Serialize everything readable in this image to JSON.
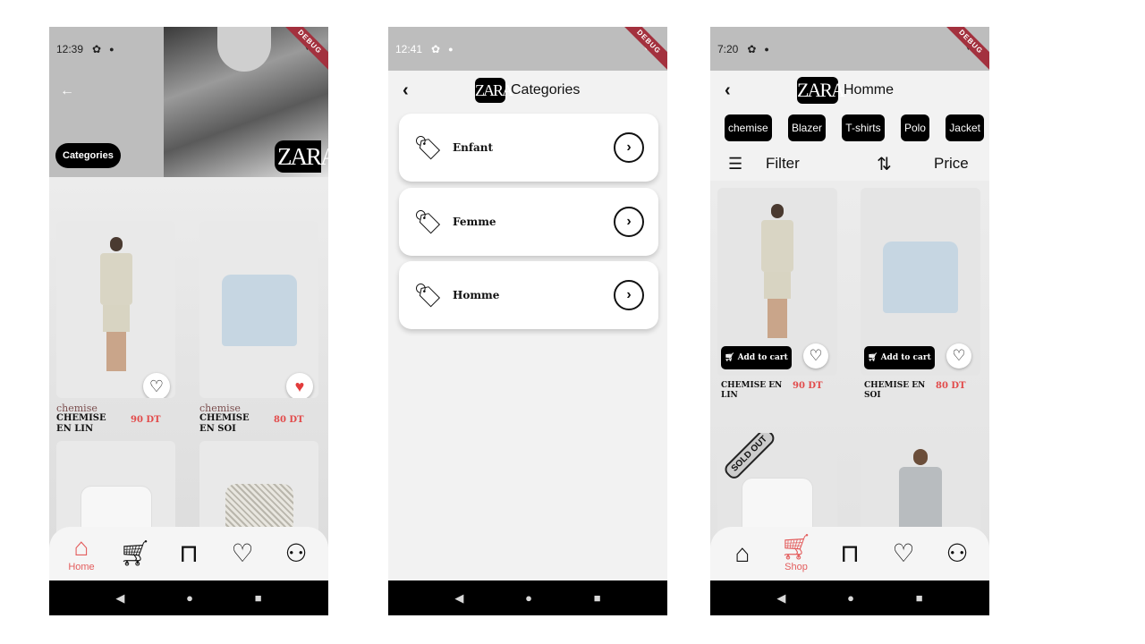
{
  "phone1": {
    "status": {
      "time": "12:39",
      "debug": "DEBUG"
    },
    "header": {
      "categories_btn": "Categories",
      "logo": "ZARA"
    },
    "products": [
      {
        "category": "chemise",
        "name": "CHEMISE EN LIN",
        "price": "90 DT",
        "favorite": false
      },
      {
        "category": "chemise",
        "name": "CHEMISE EN SOI",
        "price": "80 DT",
        "favorite": true
      }
    ],
    "nav": {
      "home_label": "Home"
    }
  },
  "phone2": {
    "status": {
      "time": "12:41",
      "debug": "DEBUG"
    },
    "appbar": {
      "logo": "ZARA",
      "title": "Categories"
    },
    "categories": [
      {
        "name": "Enfant"
      },
      {
        "name": "Femme"
      },
      {
        "name": "Homme"
      }
    ]
  },
  "phone3": {
    "status": {
      "time": "7:20",
      "debug": "DEBUG"
    },
    "appbar": {
      "logo": "ZARA",
      "title": "Homme"
    },
    "chips": [
      "chemise",
      "Blazer",
      "T-shirts",
      "Polo",
      "Jacket"
    ],
    "filter_label": "Filter",
    "sort_label": "Price",
    "products": [
      {
        "name": "CHEMISE EN LIN",
        "price": "90 DT",
        "cart_label": "Add to cart"
      },
      {
        "name": "CHEMISE EN SOI",
        "price": "80 DT",
        "cart_label": "Add to cart"
      }
    ],
    "sold_out": "SOLD OUT",
    "nav": {
      "shop_label": "Shop"
    }
  },
  "colors": {
    "accent": "#e35d5d",
    "price": "#e24a4a",
    "black": "#000000"
  }
}
